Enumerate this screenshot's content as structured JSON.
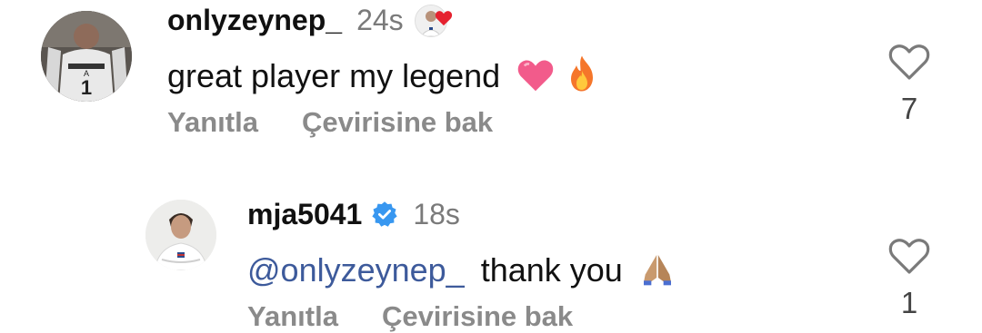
{
  "comments": [
    {
      "username": "onlyzeynep_",
      "time": "24s",
      "text": "great player my legend",
      "emojis": [
        "pink-heart",
        "fire"
      ],
      "actions": {
        "reply": "Yanıtla",
        "translate": "Çevirisine bak"
      },
      "likes": "7",
      "liked_by_author": true
    },
    {
      "username": "mja5041",
      "verified": true,
      "time": "18s",
      "mention": "@onlyzeynep_",
      "text": "thank you",
      "emojis": [
        "folded-hands"
      ],
      "actions": {
        "reply": "Yanıtla",
        "translate": "Çevirisine bak"
      },
      "likes": "1"
    }
  ],
  "colors": {
    "username": "#111111",
    "time": "#7a7a7a",
    "action": "#8a8a8a",
    "mention": "#3d5a9b",
    "verified": "#3897f0",
    "heart_red": "#e5222f"
  }
}
